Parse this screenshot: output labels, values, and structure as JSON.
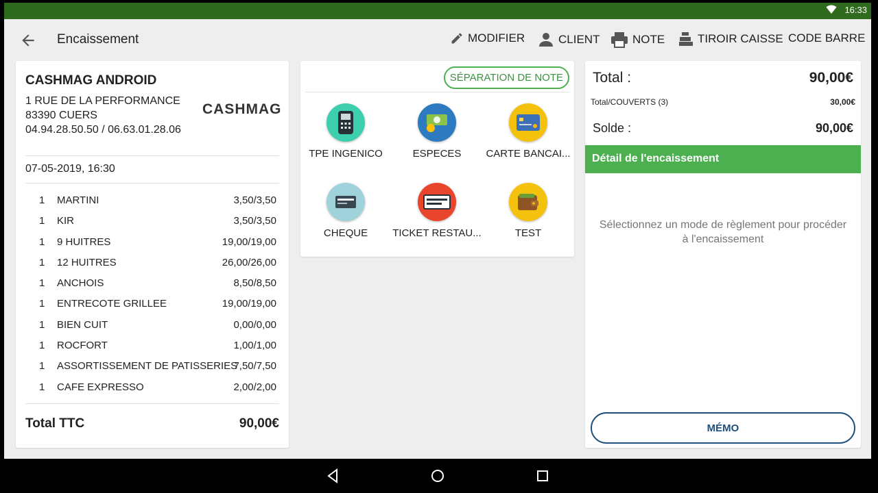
{
  "status": {
    "time": "16:33"
  },
  "toolbar": {
    "title": "Encaissement",
    "modifier": "MODIFIER",
    "client": "CLIENT",
    "note": "NOTE",
    "tiroir": "TIROIR CAISSE",
    "code_barre": "CODE BARRE"
  },
  "receipt": {
    "shop_name": "CASHMAG ANDROID",
    "address1": "1 RUE DE LA PERFORMANCE",
    "address2": "83390 CUERS",
    "phones": "04.94.28.50.50 / 06.63.01.28.06",
    "logo": "CASHMAG",
    "date": "07-05-2019, 16:30",
    "lines": [
      {
        "qty": "1",
        "name": "MARTINI",
        "price": "3,50/3,50"
      },
      {
        "qty": "1",
        "name": "KIR",
        "price": "3,50/3,50"
      },
      {
        "qty": "1",
        "name": "9 HUITRES",
        "price": "19,00/19,00"
      },
      {
        "qty": "1",
        "name": "12 HUITRES",
        "price": "26,00/26,00"
      },
      {
        "qty": "1",
        "name": "ANCHOIS",
        "price": "8,50/8,50"
      },
      {
        "qty": "1",
        "name": "ENTRECOTE GRILLEE",
        "price": "19,00/19,00"
      },
      {
        "qty": "1",
        "name": "BIEN CUIT",
        "price": "0,00/0,00"
      },
      {
        "qty": "1",
        "name": "ROCFORT",
        "price": "1,00/1,00"
      },
      {
        "qty": "1",
        "name": "ASSORTISSEMENT DE PATISSERIES",
        "price": "7,50/7,50"
      },
      {
        "qty": "1",
        "name": "CAFE EXPRESSO",
        "price": "2,00/2,00"
      }
    ],
    "total_label": "Total TTC",
    "total_value": "90,00€"
  },
  "methods": {
    "split_label": "SÉPARATION DE NOTE",
    "items": [
      {
        "label": "TPE INGENICO",
        "color": "#3ccfae",
        "icon": "card-terminal-icon"
      },
      {
        "label": "ESPECES",
        "color": "#2e7ac0",
        "icon": "cash-icon"
      },
      {
        "label": "CARTE BANCAI...",
        "color": "#f4c20d",
        "icon": "credit-card-icon"
      },
      {
        "label": "CHEQUE",
        "color": "#9fd2da",
        "icon": "cheque-icon"
      },
      {
        "label": "TICKET RESTAU...",
        "color": "#e8452c",
        "icon": "ticket-restaurant-icon"
      },
      {
        "label": "TEST",
        "color": "#f4c20d",
        "icon": "wallet-icon"
      }
    ]
  },
  "totals": {
    "total_label": "Total :",
    "total_value": "90,00€",
    "couverts_label": "Total/COUVERTS (3)",
    "couverts_value": "30,00€",
    "solde_label": "Solde :",
    "solde_value": "90,00€",
    "detail_header": "Détail de l'encaissement",
    "hint": "Sélectionnez un mode de règlement pour procéder à l'encaissement",
    "memo": "MÉMO"
  }
}
